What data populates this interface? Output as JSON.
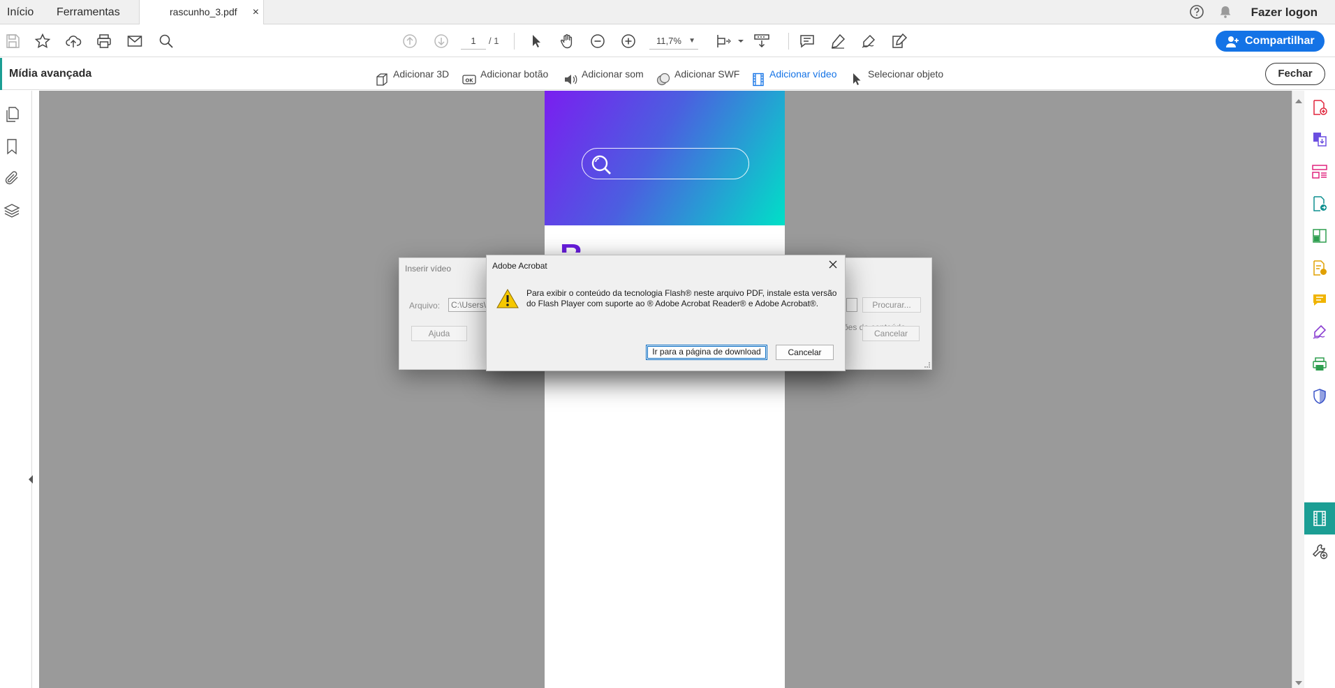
{
  "tabs": [
    {
      "label": "Início"
    },
    {
      "label": "Ferramentas"
    },
    {
      "label": "rascunho_3.pdf",
      "close": "×"
    }
  ],
  "header": {
    "login_label": "Fazer logon"
  },
  "toolbar": {
    "page_current": "1",
    "page_total": "/ 1",
    "zoom": "11,7%",
    "share_label": "Compartilhar"
  },
  "subbar": {
    "title": "Mídia avançada",
    "tools": [
      {
        "label": "Adicionar 3D",
        "icon": "cube-icon"
      },
      {
        "label": "Adicionar botão",
        "icon": "ok-button-icon"
      },
      {
        "label": "Adicionar som",
        "icon": "speaker-icon"
      },
      {
        "label": "Adicionar SWF",
        "icon": "swf-icon"
      },
      {
        "label": "Adicionar vídeo",
        "icon": "film-icon",
        "active": true
      },
      {
        "label": "Selecionar objeto",
        "icon": "pointer-icon"
      }
    ],
    "close_label": "Fechar"
  },
  "background_dialog": {
    "title": "Inserir vídeo",
    "file_label": "Arquivo:",
    "file_value": "C:\\Users\\",
    "browse_label": "Procurar...",
    "option_label": "ões do conteúdo",
    "help_label": "Ajuda",
    "cancel_label": "Cancelar"
  },
  "dialog": {
    "title": "Adobe Acrobat",
    "message": "Para exibir o conteúdo da tecnologia Flash® neste arquivo PDF, instale esta versão do Flash Player com suporte ao ® Adobe Acrobat Reader® e Adobe Acrobat®.",
    "primary_label": "Ir para a página de download",
    "cancel_label": "Cancelar"
  },
  "document": {
    "visible_letter": "R"
  },
  "colors": {
    "accent_blue": "#1473e6",
    "teal_active": "#1b9e94",
    "viewer_gray": "#9a9a9a"
  }
}
